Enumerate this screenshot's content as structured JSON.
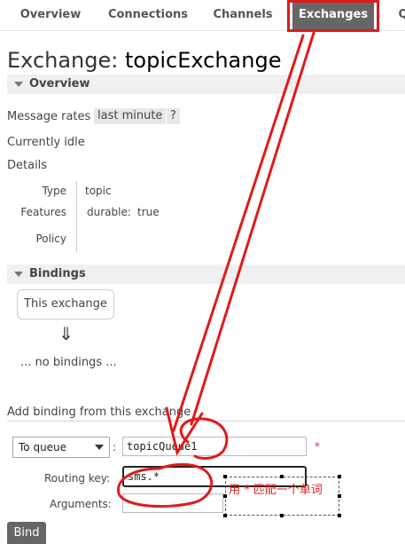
{
  "nav": {
    "tabs": [
      "Overview",
      "Connections",
      "Channels",
      "Exchanges",
      "Q"
    ],
    "active_tab": "Exchanges"
  },
  "title": {
    "prefix": "Exchange:",
    "name": "topicExchange"
  },
  "overview": {
    "section_label": "Overview",
    "message_rates_label": "Message rates",
    "message_rates_value": "last minute",
    "help": "?",
    "status": "Currently idle",
    "details_label": "Details",
    "type_label": "Type",
    "type_value": "topic",
    "features_label": "Features",
    "durable_key": "durable:",
    "durable_value": "true",
    "policy_label": "Policy"
  },
  "bindings": {
    "section_label": "Bindings",
    "this_exchange": "This exchange",
    "arrow": "⇓",
    "empty": "... no bindings ..."
  },
  "add_binding": {
    "heading": "Add binding from this exchange",
    "destination_type": "To queue",
    "destination_name": "topicQueue1",
    "required_mark": "*",
    "routing_key_label": "Routing key:",
    "routing_key_value": "sms.*",
    "arguments_label": "Arguments:",
    "arguments_value": "",
    "bind_button": "Bind",
    "colon": ":"
  },
  "annotation": {
    "text": "用 * 匹配一个单词",
    "color": "#e01b1b"
  }
}
